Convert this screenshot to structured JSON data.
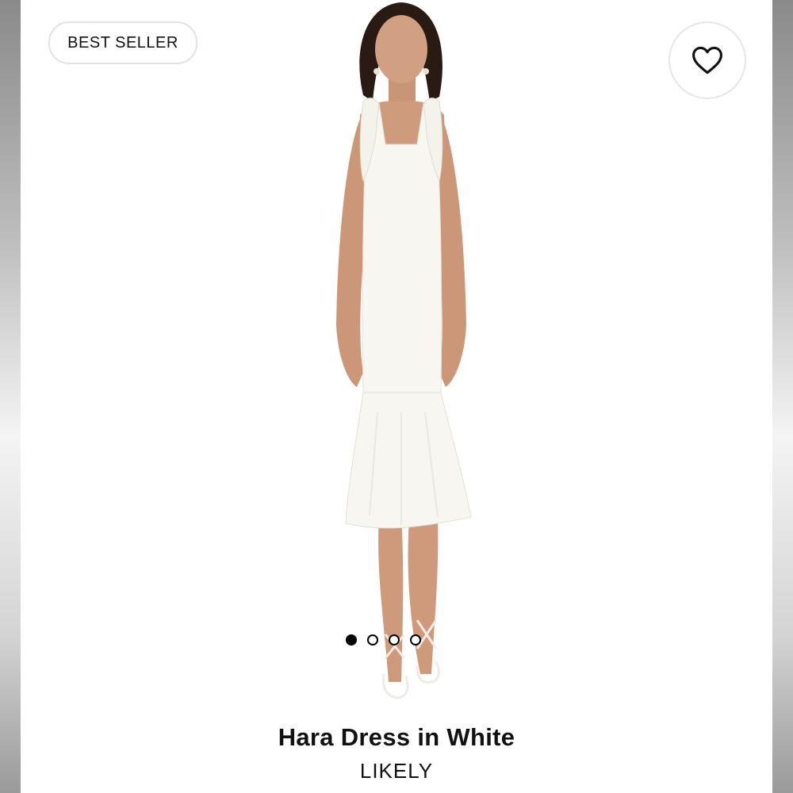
{
  "badge": {
    "label": "BEST SELLER"
  },
  "favorite": {
    "icon": "heart-icon"
  },
  "carousel": {
    "count": 4,
    "active_index": 0
  },
  "product": {
    "title": "Hara Dress in White",
    "brand": "LIKELY"
  },
  "colors": {
    "accent": "#000000",
    "border": "#e2e2e2"
  }
}
